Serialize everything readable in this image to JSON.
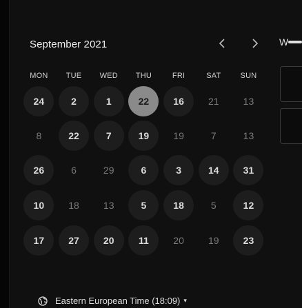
{
  "calendar": {
    "month_label": "September 2021",
    "days_of_week": [
      "MON",
      "TUE",
      "WED",
      "THU",
      "FRI",
      "SAT",
      "SUN"
    ],
    "weeks": [
      [
        {
          "label": "24",
          "state": "available"
        },
        {
          "label": "2",
          "state": "available"
        },
        {
          "label": "1",
          "state": "available"
        },
        {
          "label": "22",
          "state": "selected"
        },
        {
          "label": "16",
          "state": "available"
        },
        {
          "label": "21",
          "state": "disabled"
        },
        {
          "label": "13",
          "state": "disabled"
        }
      ],
      [
        {
          "label": "8",
          "state": "disabled"
        },
        {
          "label": "22",
          "state": "available"
        },
        {
          "label": "7",
          "state": "available"
        },
        {
          "label": "19",
          "state": "available"
        },
        {
          "label": "19",
          "state": "disabled"
        },
        {
          "label": "7",
          "state": "disabled"
        },
        {
          "label": "13",
          "state": "disabled"
        }
      ],
      [
        {
          "label": "26",
          "state": "available"
        },
        {
          "label": "6",
          "state": "disabled"
        },
        {
          "label": "29",
          "state": "disabled"
        },
        {
          "label": "6",
          "state": "available"
        },
        {
          "label": "3",
          "state": "available"
        },
        {
          "label": "14",
          "state": "available"
        },
        {
          "label": "31",
          "state": "available"
        }
      ],
      [
        {
          "label": "10",
          "state": "available"
        },
        {
          "label": "18",
          "state": "disabled"
        },
        {
          "label": "13",
          "state": "disabled"
        },
        {
          "label": "5",
          "state": "available"
        },
        {
          "label": "18",
          "state": "available"
        },
        {
          "label": "5",
          "state": "disabled"
        },
        {
          "label": "12",
          "state": "available"
        }
      ],
      [
        {
          "label": "17",
          "state": "available"
        },
        {
          "label": "27",
          "state": "available"
        },
        {
          "label": "20",
          "state": "available"
        },
        {
          "label": "11",
          "state": "available"
        },
        {
          "label": "20",
          "state": "disabled"
        },
        {
          "label": "19",
          "state": "disabled"
        },
        {
          "label": "23",
          "state": "available"
        }
      ]
    ]
  },
  "nav": {
    "prev_icon": "chevron-left-icon",
    "next_icon": "chevron-right-icon"
  },
  "side_panel": {
    "label": "W"
  },
  "timezone": {
    "label": "Eastern European Time (18:09)",
    "icon": "globe-icon",
    "caret": "▾"
  },
  "colors": {
    "background": "#101010",
    "available_bg": "#1d1d1d",
    "selected_bg": "#8a8a8a"
  }
}
